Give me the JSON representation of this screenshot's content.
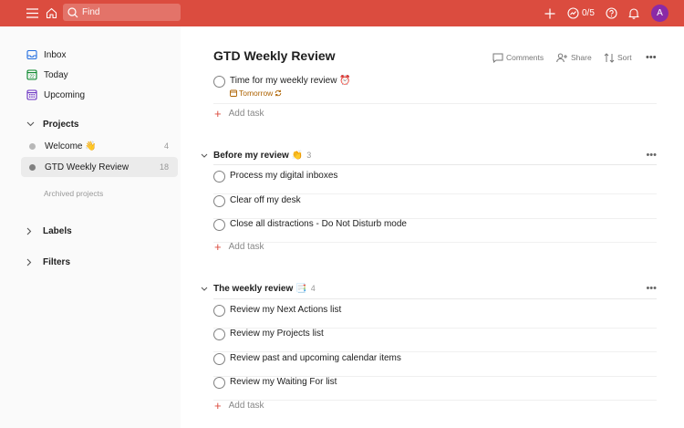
{
  "topbar": {
    "search_placeholder": "Find",
    "karma": "0/5",
    "avatar_initial": "A",
    "accent_color": "#db4c3f"
  },
  "sidebar": {
    "nav": [
      {
        "label": "Inbox",
        "icon": "inbox-icon"
      },
      {
        "label": "Today",
        "icon": "calendar-today-icon"
      },
      {
        "label": "Upcoming",
        "icon": "calendar-grid-icon"
      }
    ],
    "projects_label": "Projects",
    "projects": [
      {
        "label": "Welcome 👋",
        "count": "4"
      },
      {
        "label": "GTD Weekly Review",
        "count": "18"
      }
    ],
    "archived_label": "Archived projects",
    "labels_label": "Labels",
    "filters_label": "Filters"
  },
  "main": {
    "title": "GTD Weekly Review",
    "actions": {
      "comments": "Comments",
      "share": "Share",
      "sort": "Sort"
    },
    "top_task": {
      "text": "Time for my weekly review ⏰",
      "due": "Tomorrow"
    },
    "add_task_label": "Add task",
    "sections": [
      {
        "name": "Before my review",
        "emoji": "👏",
        "count": "3",
        "tasks": [
          "Process my digital inboxes",
          "Clear off my desk",
          "Close all distractions - Do Not Disturb mode"
        ]
      },
      {
        "name": "The weekly review",
        "emoji": "📑",
        "count": "4",
        "tasks": [
          "Review my Next Actions list",
          "Review my Projects list",
          "Review past and upcoming calendar items",
          "Review my Waiting For list"
        ]
      }
    ]
  }
}
